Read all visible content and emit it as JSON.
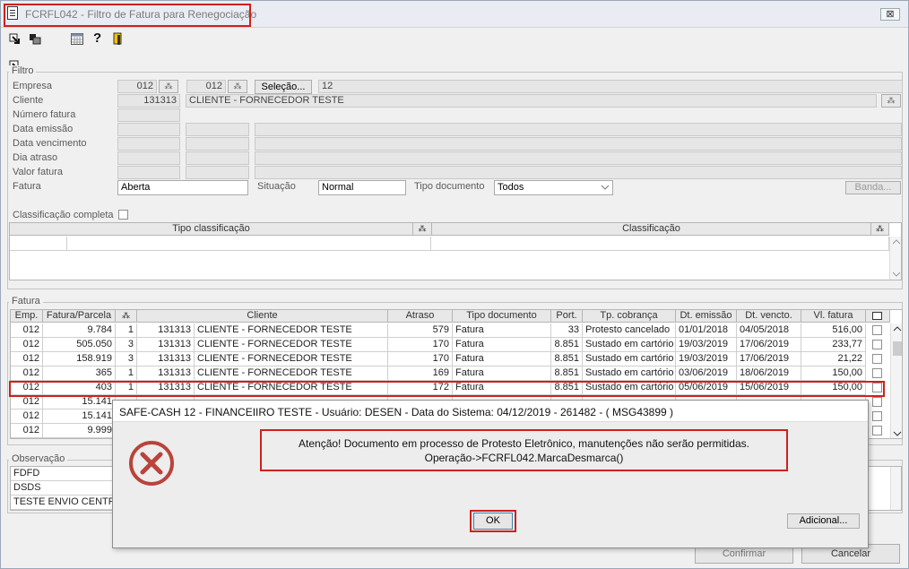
{
  "window": {
    "title": "FCRFL042 - Filtro de Fatura para Renegociação",
    "close_symbol": "⊠"
  },
  "toolbar": {
    "icons": [
      "arrow-icon",
      "copy-icon",
      "calendar-icon",
      "help-icon",
      "exit-icon"
    ]
  },
  "filtro": {
    "group_label": "Filtro",
    "empresa_label": "Empresa",
    "empresa_from": "012",
    "empresa_to": "012",
    "selecao_button": "Seleção...",
    "empresa_count": "12",
    "cliente_label": "Cliente",
    "cliente_code": "131313",
    "cliente_name": "CLIENTE - FORNECEDOR TESTE",
    "numero_fatura_label": "Número fatura",
    "data_emissao_label": "Data emissão",
    "data_vencimento_label": "Data vencimento",
    "dia_atraso_label": "Dia atraso",
    "valor_fatura_label": "Valor fatura",
    "fatura_label": "Fatura",
    "fatura_value": "Aberta",
    "situacao_label": "Situação",
    "situacao_value": "Normal",
    "tipo_documento_label": "Tipo documento",
    "tipo_documento_value": "Todos",
    "banda_button": "Banda...",
    "classificacao_label": "Classificação completa",
    "col_tipo_classificacao": "Tipo classificação",
    "col_classificacao": "Classificação"
  },
  "fatura": {
    "group_label": "Fatura",
    "columns": [
      "Emp.",
      "Fatura/Parcela",
      "",
      "Cliente",
      "Atraso",
      "Tipo documento",
      "Port.",
      "Tp. cobrança",
      "Dt. emissão",
      "Dt. vencto.",
      "Vl. fatura"
    ],
    "rows": [
      {
        "emp": "012",
        "fatura": "9.784",
        "parcela": "1",
        "cliente_code": "131313",
        "cliente": "CLIENTE - FORNECEDOR TESTE",
        "atraso": "579",
        "tipo": "Fatura",
        "port": "33",
        "cobranca": "Protesto cancelado",
        "emissao": "01/01/2018",
        "vencto": "04/05/2018",
        "valor": "516,00"
      },
      {
        "emp": "012",
        "fatura": "505.050",
        "parcela": "3",
        "cliente_code": "131313",
        "cliente": "CLIENTE - FORNECEDOR TESTE",
        "atraso": "170",
        "tipo": "Fatura",
        "port": "8.851",
        "cobranca": "Sustado em cartório",
        "emissao": "19/03/2019",
        "vencto": "17/06/2019",
        "valor": "233,77"
      },
      {
        "emp": "012",
        "fatura": "158.919",
        "parcela": "3",
        "cliente_code": "131313",
        "cliente": "CLIENTE - FORNECEDOR TESTE",
        "atraso": "170",
        "tipo": "Fatura",
        "port": "8.851",
        "cobranca": "Sustado em cartório",
        "emissao": "19/03/2019",
        "vencto": "17/06/2019",
        "valor": "21,22"
      },
      {
        "emp": "012",
        "fatura": "365",
        "parcela": "1",
        "cliente_code": "131313",
        "cliente": "CLIENTE - FORNECEDOR TESTE",
        "atraso": "169",
        "tipo": "Fatura",
        "port": "8.851",
        "cobranca": "Sustado em cartório",
        "emissao": "03/06/2019",
        "vencto": "18/06/2019",
        "valor": "150,00"
      },
      {
        "emp": "012",
        "fatura": "403",
        "parcela": "1",
        "cliente_code": "131313",
        "cliente": "CLIENTE - FORNECEDOR TESTE",
        "atraso": "172",
        "tipo": "Fatura",
        "port": "8.851",
        "cobranca": "Sustado em cartório",
        "emissao": "05/06/2019",
        "vencto": "15/06/2019",
        "valor": "150,00"
      },
      {
        "emp": "012",
        "fatura": "15.141"
      },
      {
        "emp": "012",
        "fatura": "15.141"
      },
      {
        "emp": "012",
        "fatura": "9.999"
      }
    ]
  },
  "observacao": {
    "group_label": "Observação",
    "items": [
      "FDFD",
      "DSDS",
      "TESTE ENVIO CENTRA"
    ]
  },
  "footer": {
    "confirmar": "Confirmar",
    "cancelar": "Cancelar"
  },
  "dialog": {
    "title": "SAFE-CASH 12 - FINANCEIIRO TESTE - Usuário: DESEN - Data do Sistema: 04/12/2019 - 261482 - ( MSG43899 )",
    "message_line1": "Atenção! Documento em processo de Protesto Eletrônico, manutenções não serão permitidas.",
    "message_line2": "Operação->FCRFL042.MarcaDesmarca()",
    "ok_button": "OK",
    "adicional_button": "Adicional...",
    "icon": "error-icon"
  }
}
